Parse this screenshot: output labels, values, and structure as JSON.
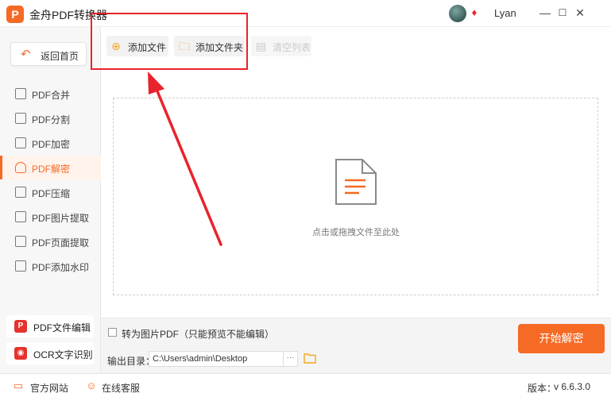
{
  "app": {
    "logo_text": "P",
    "title": "金舟PDF转换器"
  },
  "user": {
    "name": "Lyan",
    "avatar_icon": "user-avatar",
    "badge_icon": "vip-diamond-icon"
  },
  "window_controls": {
    "minimize": "—",
    "restore": "☐",
    "close": "✕"
  },
  "sidebar": {
    "home_label": "返回首页",
    "items": [
      {
        "label": "PDF合并",
        "icon": "merge-icon",
        "active": false
      },
      {
        "label": "PDF分割",
        "icon": "split-icon",
        "active": false
      },
      {
        "label": "PDF加密",
        "icon": "lock-icon",
        "active": false
      },
      {
        "label": "PDF解密",
        "icon": "shield-unlock-icon",
        "active": true
      },
      {
        "label": "PDF压缩",
        "icon": "compress-icon",
        "active": false
      },
      {
        "label": "PDF图片提取",
        "icon": "image-extract-icon",
        "active": false
      },
      {
        "label": "PDF页面提取",
        "icon": "page-extract-icon",
        "active": false
      },
      {
        "label": "PDF添加水印",
        "icon": "watermark-icon",
        "active": false
      }
    ],
    "tools": [
      {
        "label": "PDF文件编辑",
        "icon": "pdf-edit-icon"
      },
      {
        "label": "OCR文字识别",
        "icon": "ocr-eye-icon"
      }
    ]
  },
  "toolbar": {
    "add_file": "添加文件",
    "add_folder": "添加文件夹",
    "clear_list": "清空列表"
  },
  "dropzone": {
    "hint": "点击或拖拽文件至此处"
  },
  "settings": {
    "convert_to_image_label": "转为图片PDF（只能预览不能编辑）",
    "convert_to_image_checked": false,
    "output_label": "输出目录：",
    "output_path": "C:\\Users\\admin\\Desktop",
    "browse_label": "···",
    "start_label": "开始解密"
  },
  "statusbar": {
    "website": "官方网站",
    "support": "在线客服",
    "version_label": "版本：",
    "version": "v 6.6.3.0"
  },
  "colors": {
    "accent": "#f56a24",
    "annotation_red": "#e8232b"
  }
}
